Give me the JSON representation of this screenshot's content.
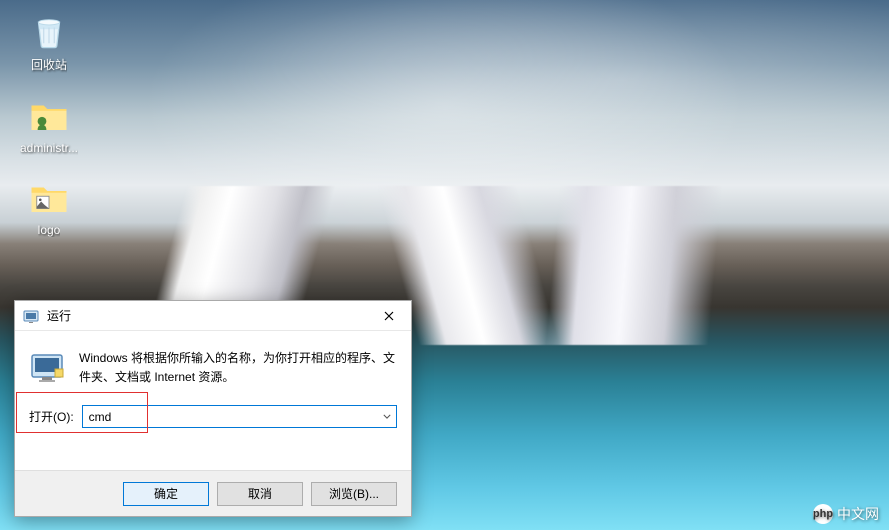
{
  "desktop": {
    "icons": [
      {
        "name": "recycle-bin",
        "label": "回收站"
      },
      {
        "name": "folder-administr",
        "label": "administr..."
      },
      {
        "name": "folder-logo",
        "label": "logo"
      }
    ]
  },
  "watermark": {
    "text": "中文网",
    "prefix": "php"
  },
  "dialog": {
    "title": "运行",
    "description": "Windows 将根据你所输入的名称，为你打开相应的程序、文件夹、文档或 Internet 资源。",
    "open_label": "打开(O):",
    "input_value": "cmd",
    "buttons": {
      "ok": "确定",
      "cancel": "取消",
      "browse": "浏览(B)..."
    }
  }
}
